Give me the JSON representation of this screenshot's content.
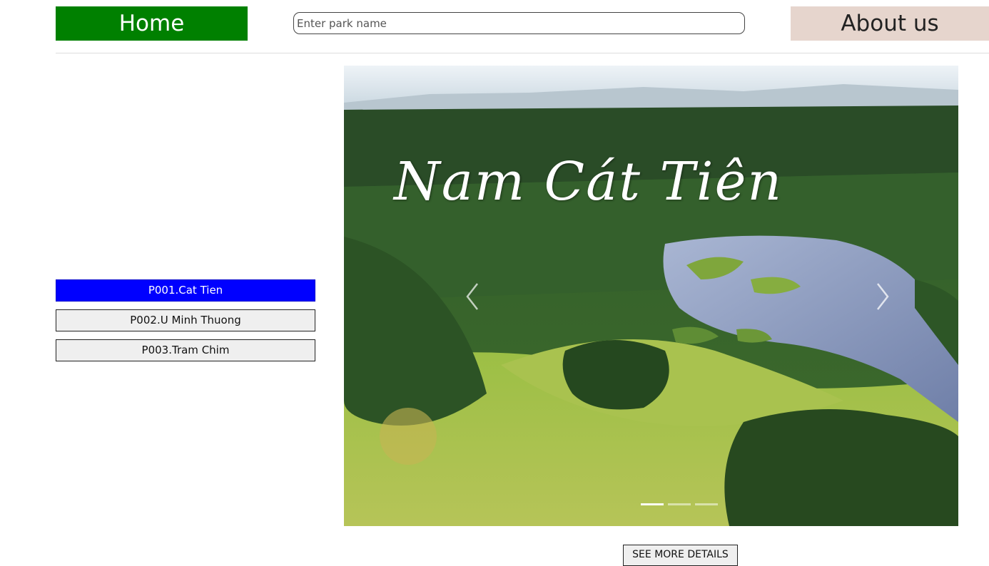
{
  "nav": {
    "home_label": "Home",
    "about_label": "About us"
  },
  "search": {
    "placeholder": "Enter park name",
    "value": ""
  },
  "parks": {
    "items": [
      {
        "label": "P001.Cat Tien",
        "selected": true
      },
      {
        "label": "P002.U Minh Thuong",
        "selected": false
      },
      {
        "label": "P003.Tram Chim",
        "selected": false
      }
    ]
  },
  "carousel": {
    "slide_title": "Nam Cát Tiên",
    "active_slide": 1,
    "slide_count": 3,
    "icons": {
      "prev": "chevron-left-icon",
      "next": "chevron-right-icon"
    }
  },
  "details_button": "SEE MORE DETAILS",
  "colors": {
    "home_bg": "#008000",
    "about_bg": "#e6d5cd",
    "selected_park_bg": "#0000ff"
  }
}
